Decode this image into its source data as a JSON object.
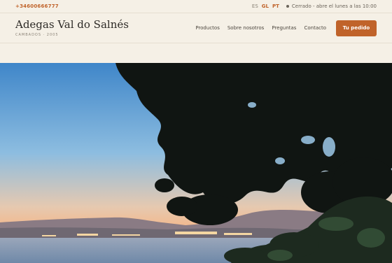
{
  "topbar": {
    "phone": "+34600666777",
    "languages": [
      {
        "code": "ES",
        "active": false
      },
      {
        "code": "GL",
        "active": true
      },
      {
        "code": "PT",
        "active": true
      }
    ],
    "status_text": "Cerrado - abre el lunes a las 10:00"
  },
  "header": {
    "brand_title": "Adegas Val do Salnés",
    "brand_subtitle": "CAMBADOS · 2005",
    "nav": [
      "Productos",
      "Sobre nosotros",
      "Preguntas",
      "Contacto"
    ],
    "cta_label": "Tu pedido"
  },
  "colors": {
    "accent": "#c0632a",
    "background": "#f5f0e6"
  },
  "hero": {
    "scene": "coastal-sunset-with-pine-trees"
  }
}
